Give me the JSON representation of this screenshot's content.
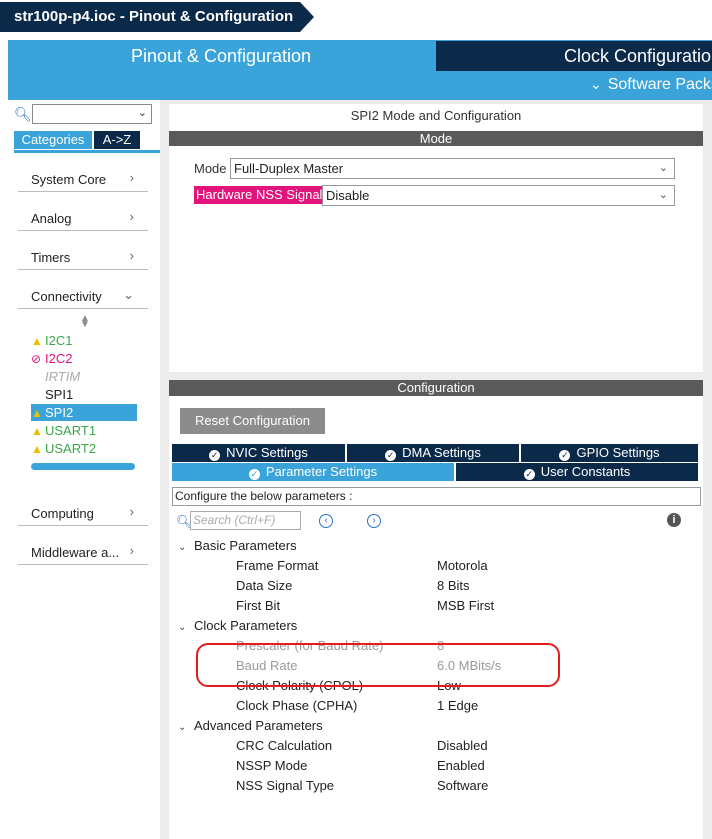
{
  "window": {
    "breadcrumb": "str100p-p4.ioc - Pinout & Configuration"
  },
  "top_tabs": {
    "pinout": "Pinout & Configuration",
    "clock": "Clock Configuration",
    "software_packs": "Software Packs"
  },
  "left": {
    "search_value": "",
    "tab_categories": "Categories",
    "tab_az": "A->Z",
    "categories": [
      {
        "label": "System Core",
        "chevron": "›"
      },
      {
        "label": "Analog",
        "chevron": "›"
      },
      {
        "label": "Timers",
        "chevron": "›"
      },
      {
        "label": "Connectivity",
        "chevron": "⌄"
      }
    ],
    "peripherals": [
      {
        "label": "I2C1",
        "status": "warning",
        "color": "#3aa54a"
      },
      {
        "label": "I2C2",
        "status": "error",
        "color": "#e0147a"
      },
      {
        "label": "IRTIM",
        "status": "disabled",
        "color": "#aaaaaa"
      },
      {
        "label": "SPI1",
        "status": "none",
        "color": "#222222"
      },
      {
        "label": "SPI2",
        "status": "warning",
        "color": "#ffffff"
      },
      {
        "label": "USART1",
        "status": "warning",
        "color": "#3aa54a"
      },
      {
        "label": "USART2",
        "status": "warning",
        "color": "#3aa54a"
      }
    ],
    "more_categories": [
      {
        "label": "Computing",
        "chevron": "›"
      },
      {
        "label": "Middleware a...",
        "chevron": "›"
      }
    ]
  },
  "mode": {
    "title": "SPI2 Mode and Configuration",
    "header": "Mode",
    "mode_label": "Mode",
    "mode_value": "Full-Duplex Master",
    "nss_label": "Hardware NSS Signal",
    "nss_value": "Disable"
  },
  "config": {
    "header": "Configuration",
    "reset_button": "Reset Configuration",
    "tabs_row1": [
      "NVIC Settings",
      "DMA Settings",
      "GPIO Settings"
    ],
    "tabs_row2": [
      "Parameter Settings",
      "User Constants"
    ],
    "configure_text": "Configure the below parameters :",
    "search_placeholder": "Search (Ctrl+F)",
    "groups": [
      {
        "name": "Basic Parameters",
        "params": [
          {
            "name": "Frame Format",
            "value": "Motorola"
          },
          {
            "name": "Data Size",
            "value": "8 Bits"
          },
          {
            "name": "First Bit",
            "value": "MSB First"
          }
        ]
      },
      {
        "name": "Clock Parameters",
        "params": [
          {
            "name": "Prescaler (for Baud Rate)",
            "value": "8"
          },
          {
            "name": "Baud Rate",
            "value": "6.0 MBits/s"
          },
          {
            "name": "Clock Polarity (CPOL)",
            "value": "Low"
          },
          {
            "name": "Clock Phase (CPHA)",
            "value": "1 Edge"
          }
        ]
      },
      {
        "name": "Advanced Parameters",
        "params": [
          {
            "name": "CRC Calculation",
            "value": "Disabled"
          },
          {
            "name": "NSSP Mode",
            "value": "Enabled"
          },
          {
            "name": "NSS Signal Type",
            "value": "Software"
          }
        ]
      }
    ]
  },
  "colors": {
    "accent_blue": "#3aa4da",
    "navy": "#0b2a4a",
    "nss_magenta": "#e0147a",
    "annotation_red": "#e51c1c"
  }
}
